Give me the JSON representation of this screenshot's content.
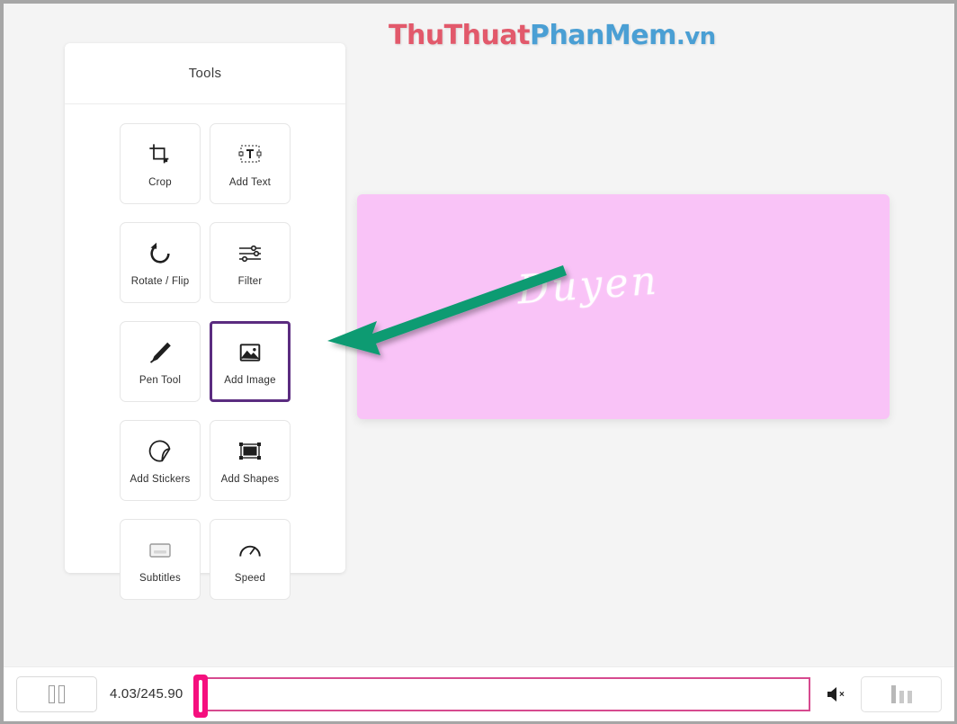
{
  "watermark": {
    "part1": "ThuThuat",
    "part2": "PhanMem",
    "part3": ".vn",
    "color1": "#e2596b",
    "color2": "#4a9fd4"
  },
  "tools_panel": {
    "title": "Tools",
    "selected_tool": "Add Image",
    "selection_color": "#5b2c80",
    "items": [
      {
        "label": "Crop",
        "icon": "crop-icon"
      },
      {
        "label": "Add Text",
        "icon": "text-icon"
      },
      {
        "label": "Rotate / Flip",
        "icon": "rotate-icon"
      },
      {
        "label": "Filter",
        "icon": "filter-sliders-icon"
      },
      {
        "label": "Pen Tool",
        "icon": "pen-icon"
      },
      {
        "label": "Add Image",
        "icon": "image-icon"
      },
      {
        "label": "Add Stickers",
        "icon": "sticker-icon"
      },
      {
        "label": "Add Shapes",
        "icon": "shapes-icon"
      },
      {
        "label": "Subtitles",
        "icon": "subtitles-icon"
      },
      {
        "label": "Speed",
        "icon": "speedometer-icon"
      }
    ]
  },
  "canvas": {
    "background_color": "#f9c3f7",
    "overlay_text": "Duyen"
  },
  "annotation": {
    "arrow_color": "#0f9b72",
    "direction": "points-left-to-add-image"
  },
  "player": {
    "play_pause_icon": "pause-icon",
    "time": "4.03/245.90",
    "current_time": "4.03",
    "total_time": "245.90",
    "playhead_position_percent": 0,
    "mute_icon": "speaker-muted-icon",
    "volume_icon": "equalizer-icon",
    "timeline_color": "#d64a8f",
    "playhead_color": "#f50f7e"
  }
}
